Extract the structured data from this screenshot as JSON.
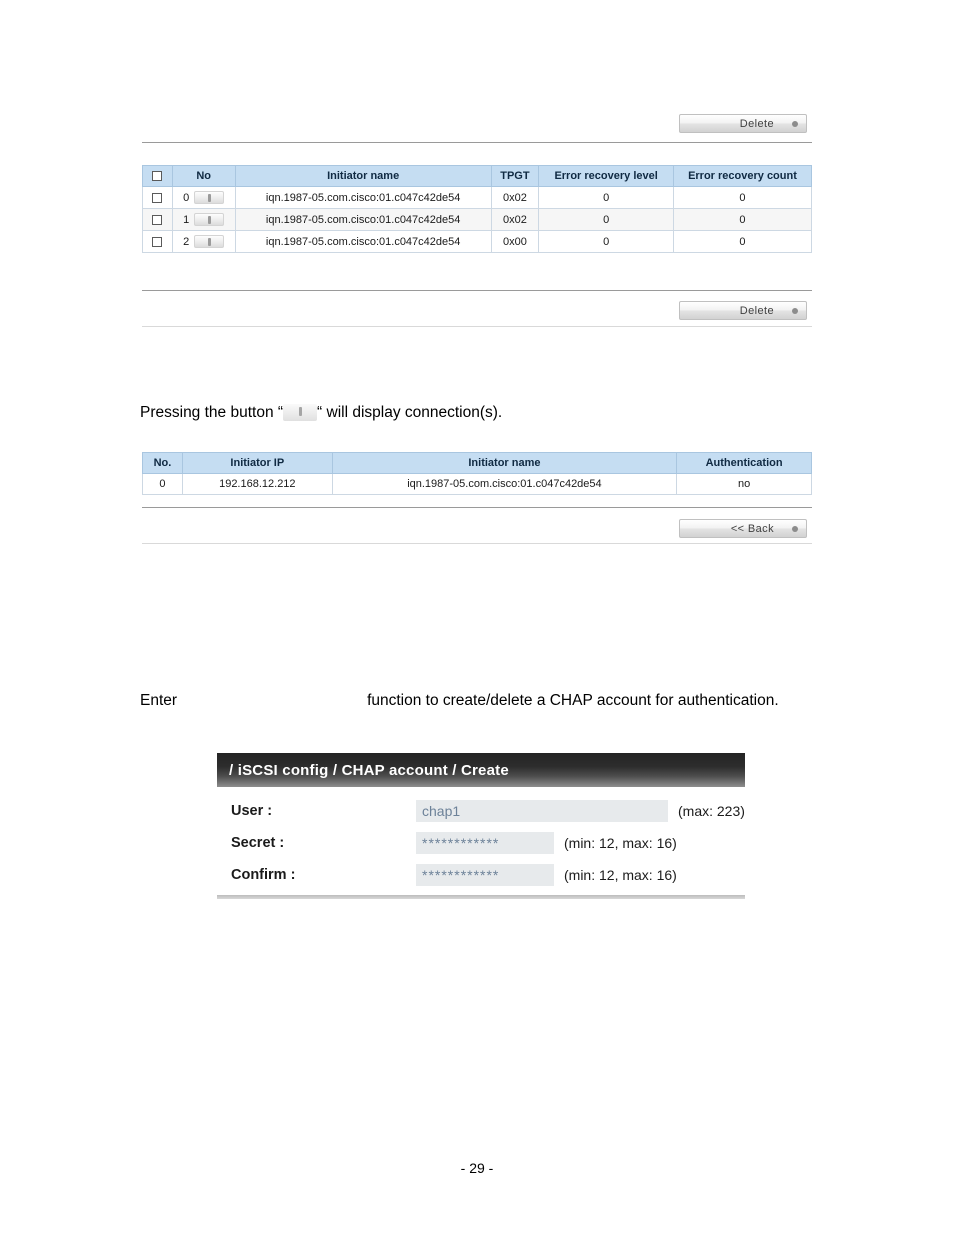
{
  "document": {
    "page_number_label": "- 29 -"
  },
  "top_section": {
    "delete_button_top": {
      "label": "Delete",
      "icon": "dot-icon"
    },
    "delete_button_bottom": {
      "label": "Delete",
      "icon": "dot-icon"
    },
    "session_table": {
      "headers": {
        "select": "",
        "no": "No",
        "initiator_name": "Initiator name",
        "tpgt": "TPGT",
        "error_recovery_level": "Error recovery level",
        "error_recovery_count": "Error recovery count"
      },
      "rows": [
        {
          "no": "0",
          "initiator_name": "iqn.1987-05.com.cisco:01.c047c42de54",
          "tpgt": "0x02",
          "error_recovery_level": "0",
          "error_recovery_count": "0"
        },
        {
          "no": "1",
          "initiator_name": "iqn.1987-05.com.cisco:01.c047c42de54",
          "tpgt": "0x02",
          "error_recovery_level": "0",
          "error_recovery_count": "0"
        },
        {
          "no": "2",
          "initiator_name": "iqn.1987-05.com.cisco:01.c047c42de54",
          "tpgt": "0x00",
          "error_recovery_level": "0",
          "error_recovery_count": "0"
        }
      ]
    }
  },
  "connection_section": {
    "paragraph_prefix": "Pressing the button “",
    "paragraph_suffix": "“ will display connection(s).",
    "connection_table": {
      "headers": {
        "no": "No.",
        "initiator_ip": "Initiator IP",
        "initiator_name": "Initiator name",
        "authentication": "Authentication"
      },
      "rows": [
        {
          "no": "0",
          "initiator_ip": "192.168.12.212",
          "initiator_name": "iqn.1987-05.com.cisco:01.c047c42de54",
          "authentication": "no"
        }
      ]
    },
    "back_button": {
      "label": "<< Back",
      "icon": "dot-icon"
    }
  },
  "chap_section": {
    "paragraph_start": "Enter",
    "paragraph_rest": "function to create/delete a CHAP account for authentication.",
    "dialog": {
      "title": "/ iSCSI config / CHAP account / Create",
      "fields": [
        {
          "label": "User :",
          "value": "chap1",
          "placeholder": "chap1",
          "hint": "(max: 223)",
          "size": "wide"
        },
        {
          "label": "Secret :",
          "value": "************",
          "placeholder": "",
          "hint": "(min: 12, max: 16)",
          "size": "narrow"
        },
        {
          "label": "Confirm :",
          "value": "************",
          "placeholder": "",
          "hint": "(min: 12, max: 16)",
          "size": "narrow"
        }
      ]
    }
  },
  "colors": {
    "table_header_bg": "#c5ddf2",
    "table_header_border": "#a9c6e0",
    "row_alt_bg": "#f6f6f6",
    "input_bg": "#e7eaec",
    "input_text": "#6d8299",
    "dialog_title_dark": "#242424",
    "rule": "#9a9a9a"
  }
}
